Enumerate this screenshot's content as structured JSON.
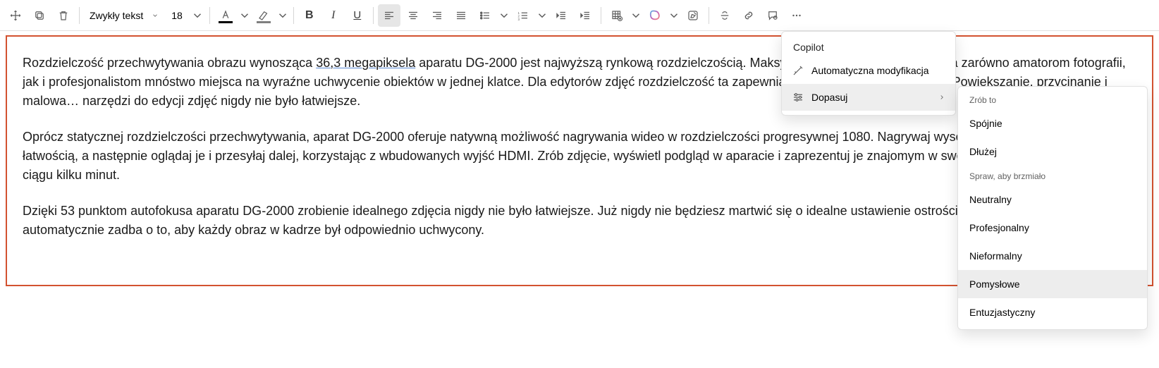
{
  "toolbar": {
    "style_label": "Zwykły tekst",
    "font_size": "18"
  },
  "document": {
    "p1_a": "Rozdzielczość przechwytywania obrazu wynosząca ",
    "p1_link": "36,3 megapiksela",
    "p1_b": " aparatu DG-2000 jest najwyższą rynkową rozdzielczością. Maksymalna rozdzielczość zapewnia zarówno amatorom fotografii, jak i profesjonalistom mnóstwo miejsca na wyraźne uchwycenie obiektów w jednej klatce. Dla edytorów zdjęć rozdzielczość ta zapewnia szeroką przestrzeń roboczą: Powiększanie, przycinanie i malowa… narzędzi do edycji zdjęć nigdy nie było łatwiejsze.",
    "p2": "Oprócz statycznej rozdzielczości przechwytywania, aparat DG-2000 oferuje natywną możliwość nagrywania wideo w rozdzielczości progresywnej 1080. Nagrywaj wysokiej jakości filmy HD z łatwością, a następnie oglądaj je i przesyłaj dalej, korzystając z wbudowanych wyjść HDMI. Zrób zdjęcie, wyświetl podgląd w aparacie i zaprezentuj je znajomym w swoim salonie — wszystko w ciągu kilku minut.",
    "p3": "Dzięki 53 punktom autofokusa aparatu DG-2000 zrobienie idealnego zdjęcia nigdy nie było łatwiejsze. Już nigdy nie będziesz martwić się o idealne ustawienie ostrości, ponieważ aparat DG-2000 automatycznie zadba o to, aby każdy obraz w kadrze był odpowiednio uchwycony."
  },
  "copilot_menu": {
    "title": "Copilot",
    "auto_modify": "Automatyczna modyfikacja",
    "adjust": "Dopasuj"
  },
  "submenu": {
    "group1": "Zrób to",
    "coherent": "Spójnie",
    "longer": "Dłużej",
    "group2": "Spraw, aby brzmiało",
    "neutral": "Neutralny",
    "professional": "Profesjonalny",
    "informal": "Nieformalny",
    "inventive": "Pomysłowe",
    "enthusiastic": "Entuzjastyczny"
  }
}
